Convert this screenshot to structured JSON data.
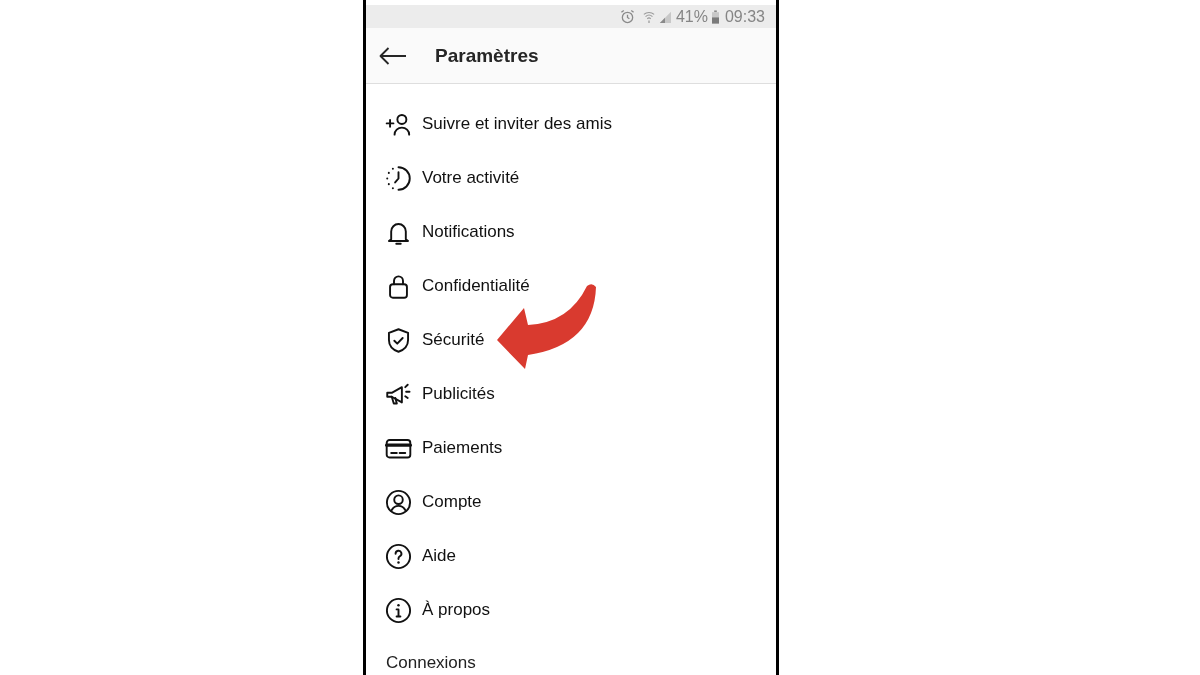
{
  "status_bar": {
    "battery": "41%",
    "time": "09:33"
  },
  "header": {
    "title": "Paramètres"
  },
  "items": [
    {
      "label": "Suivre et inviter des amis",
      "highlighted": false
    },
    {
      "label": "Votre activité",
      "highlighted": false
    },
    {
      "label": "Notifications",
      "highlighted": false
    },
    {
      "label": "Confidentialité",
      "highlighted": false
    },
    {
      "label": "Sécurité",
      "highlighted": true
    },
    {
      "label": "Publicités",
      "highlighted": false
    },
    {
      "label": "Paiements",
      "highlighted": false
    },
    {
      "label": "Compte",
      "highlighted": false
    },
    {
      "label": "Aide",
      "highlighted": false
    },
    {
      "label": "À propos",
      "highlighted": false
    }
  ],
  "section_heading": "Connexions"
}
